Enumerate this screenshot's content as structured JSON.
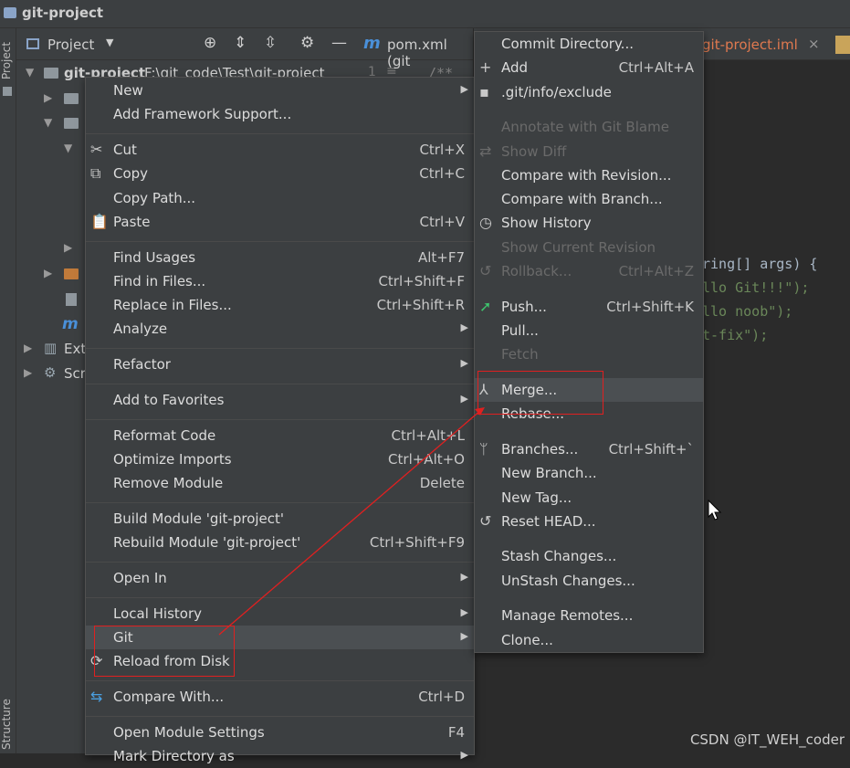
{
  "window": {
    "title": "git-project"
  },
  "left_stripe": {
    "top_label": "Project",
    "bottom_label": "Structure"
  },
  "project_panel": {
    "title": "Project",
    "root": {
      "name": "git-project",
      "path": "F:\\git_code\\Test\\git-project"
    },
    "external_label": "Ext",
    "scratches_label": "Scr"
  },
  "editor": {
    "tabs": [
      {
        "label": "pom.xml (git"
      },
      {
        "label": "git-project.iml"
      }
    ],
    "line_number": "1",
    "comment": "/**",
    "lines": [
      {
        "text": "ring[] args) {"
      },
      {
        "text": "llo Git!!!\");"
      },
      {
        "text": "llo noob\");"
      },
      {
        "text": "t-fix\");"
      }
    ]
  },
  "context_menu": {
    "items": [
      {
        "label": "New",
        "submenu": true
      },
      {
        "label": "Add Framework Support..."
      },
      {
        "label": "Cut",
        "shortcut": "Ctrl+X",
        "icon": "scissors-icon"
      },
      {
        "label": "Copy",
        "shortcut": "Ctrl+C",
        "icon": "copy-icon"
      },
      {
        "label": "Copy Path..."
      },
      {
        "label": "Paste",
        "shortcut": "Ctrl+V",
        "icon": "clipboard-icon"
      },
      {
        "label": "Find Usages",
        "shortcut": "Alt+F7"
      },
      {
        "label": "Find in Files...",
        "shortcut": "Ctrl+Shift+F"
      },
      {
        "label": "Replace in Files...",
        "shortcut": "Ctrl+Shift+R"
      },
      {
        "label": "Analyze",
        "submenu": true
      },
      {
        "label": "Refactor",
        "submenu": true
      },
      {
        "label": "Add to Favorites",
        "submenu": true
      },
      {
        "label": "Reformat Code",
        "shortcut": "Ctrl+Alt+L"
      },
      {
        "label": "Optimize Imports",
        "shortcut": "Ctrl+Alt+O"
      },
      {
        "label": "Remove Module",
        "shortcut": "Delete"
      },
      {
        "label": "Build Module 'git-project'"
      },
      {
        "label": "Rebuild Module 'git-project'",
        "shortcut": "Ctrl+Shift+F9"
      },
      {
        "label": "Open In",
        "submenu": true
      },
      {
        "label": "Local History",
        "submenu": true
      },
      {
        "label": "Git",
        "submenu": true,
        "selected": true
      },
      {
        "label": "Reload from Disk",
        "icon": "reload-icon"
      },
      {
        "label": "Compare With...",
        "shortcut": "Ctrl+D",
        "icon": "compare-icon"
      },
      {
        "label": "Open Module Settings",
        "shortcut": "F4"
      },
      {
        "label": "Mark Directory as",
        "submenu": true
      }
    ]
  },
  "git_menu": {
    "items": [
      {
        "label": "Commit Directory..."
      },
      {
        "label": "Add",
        "shortcut": "Ctrl+Alt+A",
        "icon": "plus-icon"
      },
      {
        "label": ".git/info/exclude",
        "icon": "git-file-icon"
      },
      {
        "label": "Annotate with Git Blame",
        "disabled": true
      },
      {
        "label": "Show Diff",
        "disabled": true,
        "icon": "diff-icon"
      },
      {
        "label": "Compare with Revision..."
      },
      {
        "label": "Compare with Branch..."
      },
      {
        "label": "Show History",
        "icon": "history-icon"
      },
      {
        "label": "Show Current Revision",
        "disabled": true
      },
      {
        "label": "Rollback...",
        "shortcut": "Ctrl+Alt+Z",
        "disabled": true,
        "icon": "rollback-icon"
      },
      {
        "label": "Push...",
        "shortcut": "Ctrl+Shift+K",
        "icon": "push-arrow-icon"
      },
      {
        "label": "Pull..."
      },
      {
        "label": "Fetch",
        "disabled": true
      },
      {
        "label": "Merge...",
        "icon": "merge-icon",
        "selected": true
      },
      {
        "label": "Rebase..."
      },
      {
        "label": "Branches...",
        "shortcut": "Ctrl+Shift+`",
        "icon": "branch-icon"
      },
      {
        "label": "New Branch..."
      },
      {
        "label": "New Tag..."
      },
      {
        "label": "Reset HEAD...",
        "icon": "reset-icon"
      },
      {
        "label": "Stash Changes..."
      },
      {
        "label": "UnStash Changes..."
      },
      {
        "label": "Manage Remotes..."
      },
      {
        "label": "Clone..."
      }
    ]
  },
  "watermark": "CSDN @IT_WEH_coder",
  "colors": {
    "background": "#2b2b2b",
    "panel": "#3c3f41",
    "menu_selection": "#4b4f52",
    "annotation_red": "#e02020",
    "push_icon_green": "#3ec46d",
    "string_green": "#6a8759"
  }
}
